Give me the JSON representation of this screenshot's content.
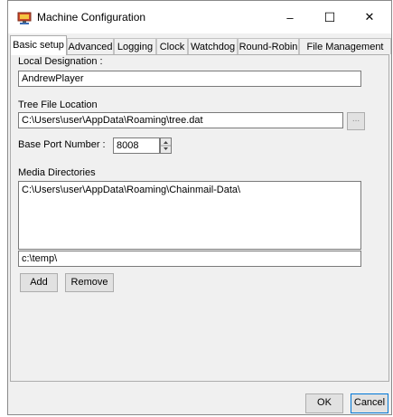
{
  "window": {
    "title": "Machine Configuration"
  },
  "titlebar_buttons": {
    "minimize": "–",
    "maximize": "☐",
    "close": "✕"
  },
  "tabs": [
    {
      "label": "Basic setup",
      "active": true
    },
    {
      "label": "Advanced"
    },
    {
      "label": "Logging"
    },
    {
      "label": "Clock"
    },
    {
      "label": "Watchdog"
    },
    {
      "label": "Round-Robin"
    },
    {
      "label": "File Management"
    }
  ],
  "basic_setup": {
    "local_designation_label": "Local Designation :",
    "local_designation_value": "AndrewPlayer",
    "tree_file_label": "Tree File Location",
    "tree_file_value": "C:\\Users\\user\\AppData\\Roaming\\tree.dat",
    "browse_label": "...",
    "base_port_label": "Base Port Number :",
    "base_port_value": "8008",
    "media_dirs_label": "Media Directories",
    "media_dirs": [
      "C:\\Users\\user\\AppData\\Roaming\\Chainmail-Data\\"
    ],
    "new_dir_value": "c:\\temp\\",
    "add_label": "Add",
    "remove_label": "Remove"
  },
  "footer": {
    "ok_label": "OK",
    "cancel_label": "Cancel"
  },
  "colors": {
    "focus_border": "#0078d7",
    "panel_bg": "#f0f0f0"
  },
  "icons": {
    "app": "machine-config-icon"
  }
}
